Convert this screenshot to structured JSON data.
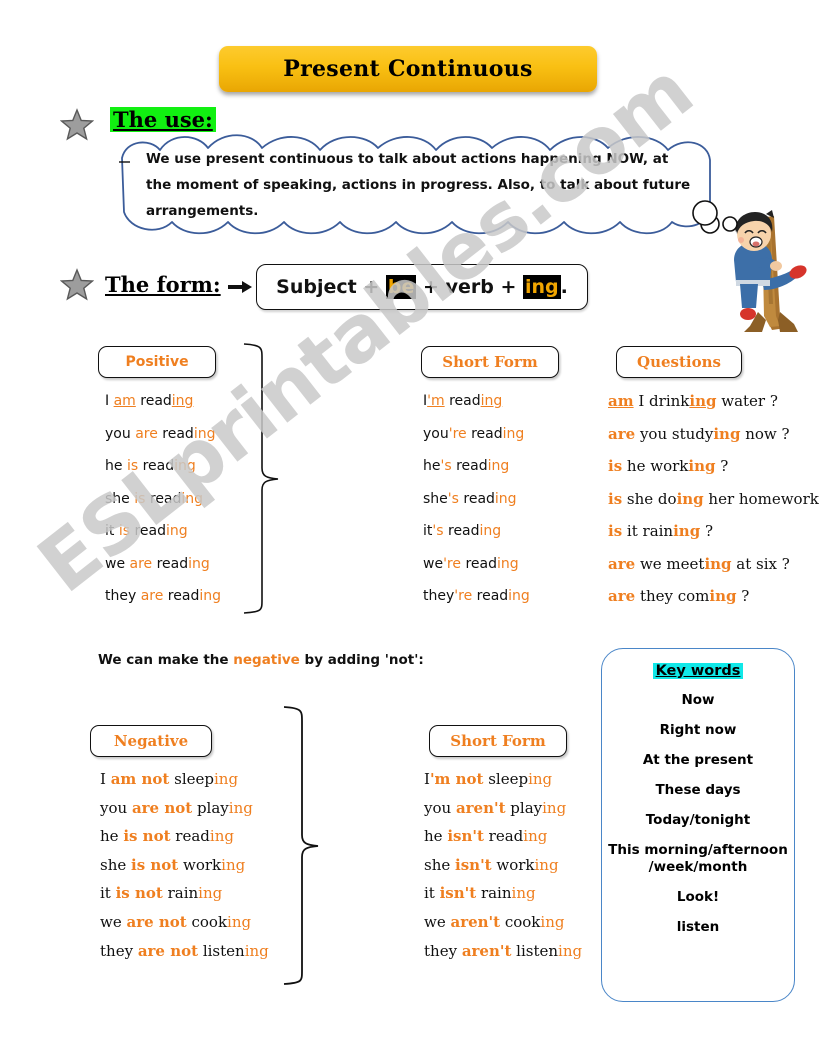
{
  "page": {
    "title": "Present Continuous",
    "watermark": "ESLprintables.com"
  },
  "colors": {
    "orange": "#ef7f20",
    "banner_gold": "#f9c013",
    "highlight_green": "#11f011",
    "highlight_cyan": "#10e8e8",
    "bubble_blue": "#3b5c9a",
    "keybox_blue": "#4a86c8"
  },
  "use_section": {
    "star": "star-icon",
    "heading": "The use:",
    "bubble_text": "We use present continuous to talk about actions happening NOW, at the moment of speaking, actions in progress. Also, to talk about future arrangements."
  },
  "form_section": {
    "star": "star-icon",
    "heading": "The form:",
    "arrow": "arrow-right-icon",
    "formula": {
      "subject": "Subject",
      "plus1": "+",
      "be": "be",
      "plus2": "+",
      "verb": "verb",
      "plus3": "+",
      "ing": "ing",
      "period": "."
    }
  },
  "positive": {
    "label": "Positive",
    "rows": [
      {
        "pronoun": "I ",
        "aux": "am",
        "stem": " read",
        "ing": "ing",
        "underline": true
      },
      {
        "pronoun": "you ",
        "aux": "are",
        "stem": " read",
        "ing": "ing",
        "underline": false
      },
      {
        "pronoun": "he ",
        "aux": "is",
        "stem": " read",
        "ing": "ing",
        "underline": false
      },
      {
        "pronoun": "she ",
        "aux": "is",
        "stem": " read",
        "ing": "ing",
        "underline": false
      },
      {
        "pronoun": "it ",
        "aux": "is",
        "stem": " read",
        "ing": "ing",
        "underline": false
      },
      {
        "pronoun": "we ",
        "aux": "are",
        "stem": " read",
        "ing": "ing",
        "underline": false
      },
      {
        "pronoun": "they ",
        "aux": "are",
        "stem": " read",
        "ing": "ing",
        "underline": false
      }
    ]
  },
  "short_form_positive": {
    "label": "Short Form",
    "rows": [
      {
        "pronoun": "I",
        "aux": "'m",
        "stem": " read",
        "ing": "ing",
        "underline": true
      },
      {
        "pronoun": "you",
        "aux": "'re",
        "stem": " read",
        "ing": "ing",
        "underline": false
      },
      {
        "pronoun": "he",
        "aux": "'s",
        "stem": " read",
        "ing": "ing",
        "underline": false
      },
      {
        "pronoun": "she",
        "aux": "'s",
        "stem": " read",
        "ing": "ing",
        "underline": false
      },
      {
        "pronoun": "it",
        "aux": "'s",
        "stem": " read",
        "ing": "ing",
        "underline": false
      },
      {
        "pronoun": "we",
        "aux": "'re",
        "stem": " read",
        "ing": "ing",
        "underline": false
      },
      {
        "pronoun": "they",
        "aux": "'re",
        "stem": " read",
        "ing": "ing",
        "underline": false
      }
    ]
  },
  "questions": {
    "label": "Questions",
    "rows": [
      {
        "aux": "am",
        "subject": " I drink",
        "ing": "ing",
        "rest": " water ?",
        "underline": true
      },
      {
        "aux": "are",
        "subject": " you study",
        "ing": "ing",
        "rest": " now ?",
        "underline": false
      },
      {
        "aux": "is",
        "subject": " he work",
        "ing": "ing",
        "rest": " ?",
        "underline": false
      },
      {
        "aux": "is",
        "subject": " she do",
        "ing": "ing",
        "rest": " her homework ?",
        "underline": false
      },
      {
        "aux": "is",
        "subject": " it rain",
        "ing": "ing",
        "rest": " ?",
        "underline": false
      },
      {
        "aux": "are",
        "subject": " we meet",
        "ing": "ing",
        "rest": " at six ?",
        "underline": false
      },
      {
        "aux": "are",
        "subject": " they com",
        "ing": "ing",
        "rest": " ?",
        "underline": false
      }
    ]
  },
  "negative_note": {
    "pre": "We can make the ",
    "highlight": "negative",
    "post": " by adding 'not':"
  },
  "negative": {
    "label": "Negative",
    "rows": [
      {
        "pronoun": "I ",
        "aux": "am not",
        "stem": " sleep",
        "ing": "ing"
      },
      {
        "pronoun": "you ",
        "aux": "are not",
        "stem": " play",
        "ing": "ing"
      },
      {
        "pronoun": "he ",
        "aux": "is not",
        "stem": " read",
        "ing": "ing"
      },
      {
        "pronoun": "she ",
        "aux": "is not",
        "stem": " work",
        "ing": "ing"
      },
      {
        "pronoun": "it ",
        "aux": "is not",
        "stem": " rain",
        "ing": "ing"
      },
      {
        "pronoun": "we ",
        "aux": "are not",
        "stem": " cook",
        "ing": "ing"
      },
      {
        "pronoun": "they ",
        "aux": "are not",
        "stem": " listen",
        "ing": "ing"
      }
    ]
  },
  "short_form_negative": {
    "label": "Short Form",
    "rows": [
      {
        "pronoun": "I",
        "aux": "'m not",
        "stem": " sleep",
        "ing": "ing"
      },
      {
        "pronoun": "you ",
        "aux": "aren't",
        "stem": " play",
        "ing": "ing"
      },
      {
        "pronoun": "he ",
        "aux": "isn't",
        "stem": " read",
        "ing": "ing"
      },
      {
        "pronoun": "she ",
        "aux": "isn't",
        "stem": " work",
        "ing": "ing"
      },
      {
        "pronoun": "it ",
        "aux": "isn't",
        "stem": " rain",
        "ing": "ing"
      },
      {
        "pronoun": "we ",
        "aux": "aren't",
        "stem": " cook",
        "ing": "ing"
      },
      {
        "pronoun": "they ",
        "aux": "aren't",
        "stem": " listen",
        "ing": "ing"
      }
    ]
  },
  "key_words": {
    "title": "Key words",
    "items": [
      "Now",
      "Right now",
      "At the present",
      "These days",
      "Today/tonight",
      "This morning/afternoon /week/month",
      "Look!",
      "listen"
    ]
  },
  "illustration": {
    "name": "boy-climbing-tree"
  }
}
